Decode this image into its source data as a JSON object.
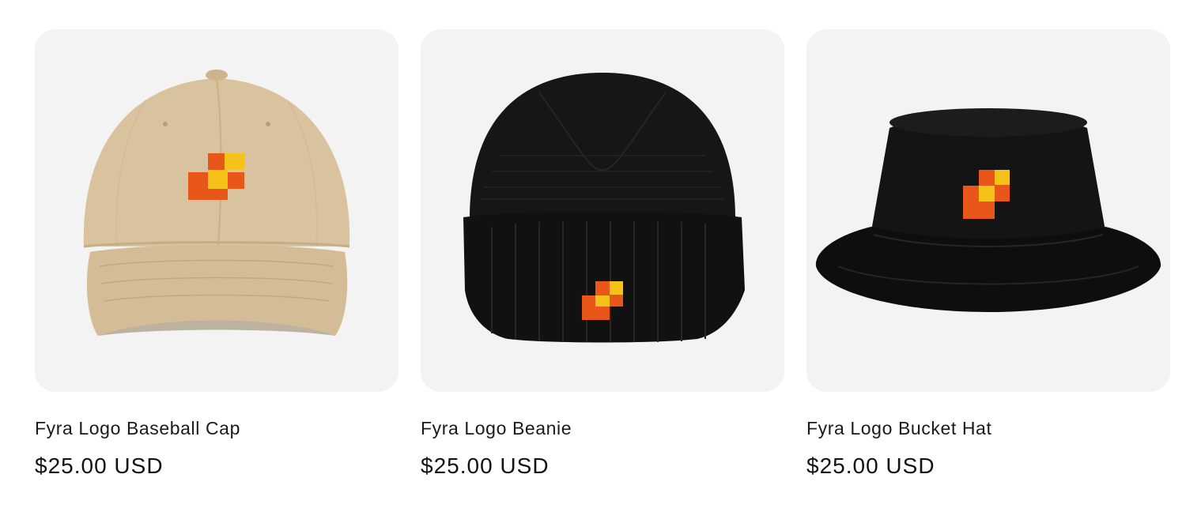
{
  "products": [
    {
      "title": "Fyra Logo Baseball Cap",
      "price": "$25.00 USD",
      "image_icon": "baseball-cap-image",
      "color": "#d8c29c"
    },
    {
      "title": "Fyra Logo Beanie",
      "price": "$25.00 USD",
      "image_icon": "beanie-image",
      "color": "#161616"
    },
    {
      "title": "Fyra Logo Bucket Hat",
      "price": "$25.00 USD",
      "image_icon": "bucket-hat-image",
      "color": "#111111"
    }
  ],
  "brand_colors": {
    "logo_orange": "#e8561a",
    "logo_yellow": "#f5c21a",
    "card_background": "#f3f3f3"
  }
}
